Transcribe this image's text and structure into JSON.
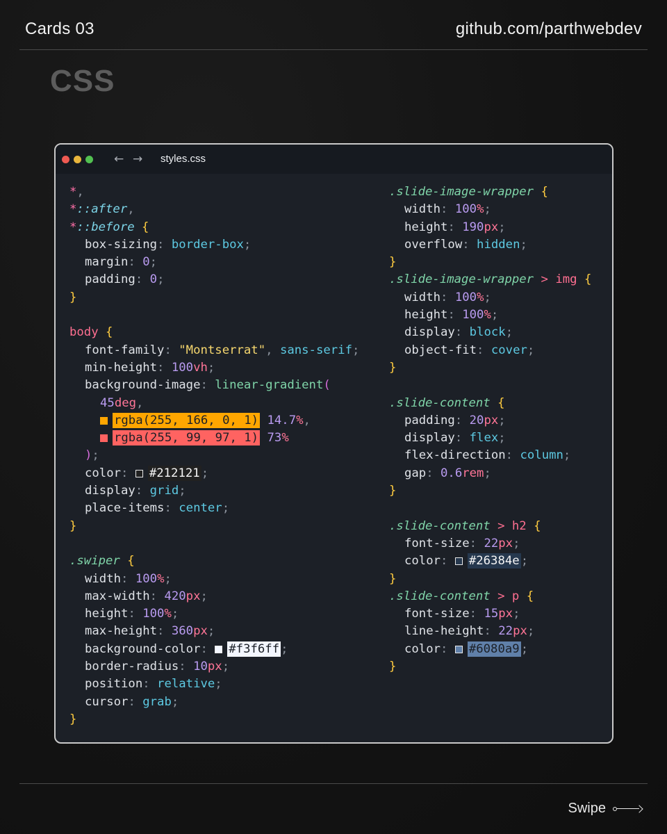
{
  "header": {
    "left_title": "Cards 03",
    "right_link": "github.com/parthwebdev"
  },
  "section_title": "CSS",
  "window": {
    "tab_title": "styles.css",
    "back_icon": "←",
    "forward_icon": "→"
  },
  "footer": {
    "swipe_label": "Swipe"
  },
  "colors": {
    "orange": "#ffa600",
    "coral": "#ff6361",
    "dark": "#212121",
    "navy": "#26384e",
    "light": "#f3f6ff",
    "slate": "#6080a9"
  },
  "code_left": {
    "sel_star": "*",
    "after": "::after",
    "before": "::before",
    "box_sizing": "box-sizing",
    "border_box": "border-box",
    "margin": "margin",
    "padding": "padding",
    "zero": "0",
    "body": "body",
    "font_family": "font-family",
    "montserrat": "\"Montserrat\"",
    "sans_serif": "sans-serif",
    "min_height": "min-height",
    "v100": "100",
    "vh": "vh",
    "background_image": "background-image",
    "linear_gradient": "linear-gradient",
    "deg45": "45",
    "deg": "deg",
    "rgba1": "rgba(255, 166, 0, 1)",
    "stop1_num": "14.7",
    "stop1_unit": "%",
    "rgba2": "rgba(255, 99, 97, 1)",
    "stop2_num": "73",
    "stop2_unit": "%",
    "color": "color",
    "hex_212121": "#212121",
    "display": "display",
    "grid": "grid",
    "place_items": "place-items",
    "center": "center",
    "swiper": ".swiper",
    "width": "width",
    "max_width": "max-width",
    "v420": "420",
    "height": "height",
    "max_height": "max-height",
    "v360": "360",
    "background_color": "background-color",
    "hex_f3f6ff": "#f3f6ff",
    "border_radius": "border-radius",
    "v10": "10",
    "px": "px",
    "pct": "%",
    "position": "position",
    "relative": "relative",
    "cursor": "cursor",
    "grab": "grab"
  },
  "code_right": {
    "siw": ".slide-image-wrapper",
    "gt": ">",
    "img": "img",
    "width": "width",
    "height": "height",
    "v100": "100",
    "pct": "%",
    "v190": "190",
    "px": "px",
    "overflow": "overflow",
    "hidden": "hidden",
    "display": "display",
    "block": "block",
    "object_fit": "object-fit",
    "cover": "cover",
    "sc": ".slide-content",
    "padding": "padding",
    "v20": "20",
    "flex": "flex",
    "flex_direction": "flex-direction",
    "column": "column",
    "gap": "gap",
    "v06": "0.6",
    "rem": "rem",
    "h2": "h2",
    "font_size": "font-size",
    "v22": "22",
    "color": "color",
    "hex_26384e": "#26384e",
    "p": "p",
    "v15": "15",
    "line_height": "line-height",
    "hex_6080a9": "#6080a9"
  }
}
